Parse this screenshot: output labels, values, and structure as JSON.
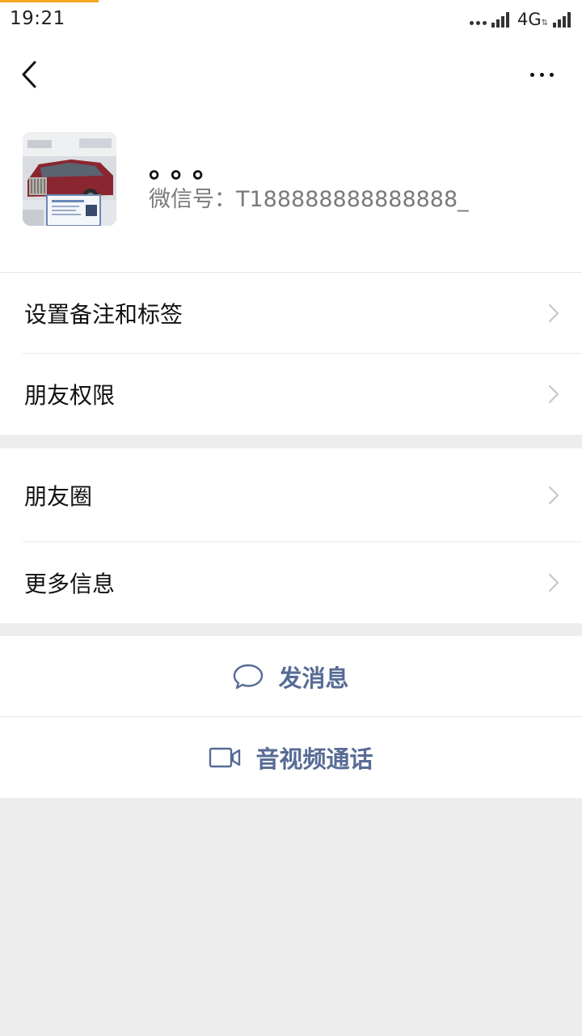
{
  "status_bar": {
    "time": "19:21",
    "network": "4G",
    "network_arrows": "⇅",
    "progress_color": "#f5a623"
  },
  "nav": {
    "back_icon": "chevron-left-icon",
    "more_icon": "more-horizontal-icon"
  },
  "profile": {
    "nickname": "。。。",
    "wechat_id": "微信号：T188888888888888_",
    "avatar_icon": "car-photo-avatar"
  },
  "menu_group_1": {
    "items": [
      {
        "label": "设置备注和标签"
      },
      {
        "label": "朋友权限"
      }
    ]
  },
  "menu_group_2": {
    "items": [
      {
        "label": "朋友圈"
      },
      {
        "label": "更多信息"
      }
    ]
  },
  "actions": {
    "send_message": {
      "label": "发消息",
      "icon": "chat-bubble-icon"
    },
    "video_call": {
      "label": "音视频通话",
      "icon": "video-camera-icon"
    },
    "accent_color": "#576b95"
  }
}
